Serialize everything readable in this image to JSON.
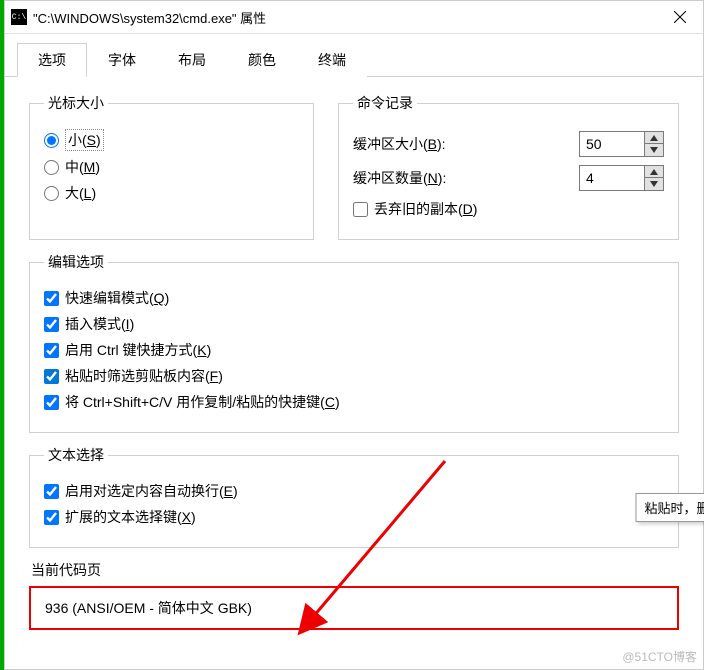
{
  "window": {
    "sys_icon": "C:\\",
    "title": "\"C:\\WINDOWS\\system32\\cmd.exe\" 属性"
  },
  "tabs": {
    "options": "选项",
    "font": "字体",
    "layout": "布局",
    "colors": "颜色",
    "terminal": "终端"
  },
  "cursor": {
    "legend": "光标大小",
    "small": "小(",
    "small_u": "S",
    "small_end": ")",
    "medium": "中(",
    "medium_u": "M",
    "medium_end": ")",
    "large": "大(",
    "large_u": "L",
    "large_end": ")"
  },
  "history": {
    "legend": "命令记录",
    "buf_size": "缓冲区大小(",
    "buf_size_u": "B",
    "buf_size_end": "):",
    "buf_size_val": "50",
    "buf_count": "缓冲区数量(",
    "buf_count_u": "N",
    "buf_count_end": "):",
    "buf_count_val": "4",
    "discard": "丢弃旧的副本(",
    "discard_u": "D",
    "discard_end": ")"
  },
  "edit": {
    "legend": "编辑选项",
    "quick": "快速编辑模式(",
    "quick_u": "Q",
    "quick_end": ")",
    "insert": "插入模式(",
    "insert_u": "I",
    "insert_end": ")",
    "ctrl": "启用 Ctrl 键快捷方式(",
    "ctrl_u": "K",
    "ctrl_end": ")",
    "paste": "粘贴时筛选剪贴板内容(",
    "paste_u": "F",
    "paste_end": ")",
    "csv": "将 Ctrl+Shift+C/V 用作复制/粘贴的快捷键(",
    "csv_u": "C",
    "csv_end": ")"
  },
  "textsel": {
    "legend": "文本选择",
    "wrap": "启用对选定内容自动换行(",
    "wrap_u": "E",
    "wrap_end": ")",
    "extkey": "扩展的文本选择键(",
    "extkey_u": "X",
    "extkey_end": ")"
  },
  "codepage": {
    "legend": "当前代码页",
    "value": "936   (ANSI/OEM - 简体中文 GBK)"
  },
  "tooltip": "粘贴时，删除制表符",
  "watermark": "@51CTO博客"
}
